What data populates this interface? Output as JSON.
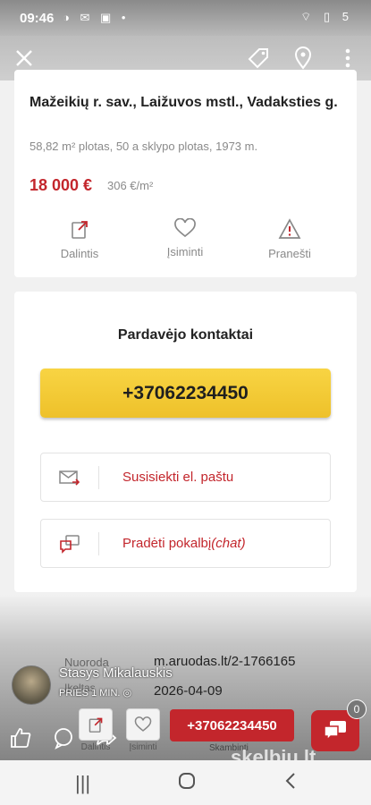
{
  "status_bar": {
    "time": "09:46",
    "left_icons": "◑ ✉ ▣ •",
    "right_icons": "⌔ ▯ 5"
  },
  "top_bar": {
    "close_icon": "close-icon",
    "tag_icon": "tag-icon",
    "location_icon": "location-pin-icon",
    "menu_icon": "more-vert-icon"
  },
  "listing": {
    "address": "Mažeikių r. sav., Laižuvos mstl., Vadaksties g.",
    "details": "58,82 m² plotas, 50 a sklypo plotas, 1973 m.",
    "price": "18 000 €",
    "price_per_m2": "306 €/m²"
  },
  "actions": [
    {
      "label": "Dalintis",
      "icon": "share-icon"
    },
    {
      "label": "Įsiminti",
      "icon": "heart-icon"
    },
    {
      "label": "Pranešti",
      "icon": "warning-icon"
    }
  ],
  "contacts": {
    "title": "Pardavėjo kontaktai",
    "phone": "+37062234450",
    "email_label": "Susisiekti el. paštu",
    "chat_label": "Pradėti pokalbį",
    "chat_suffix": "(chat)"
  },
  "reference": {
    "label": "Nuoroda",
    "value": "m.aruodas.lt/2-1766165",
    "date_label": "Įkeltas",
    "date_value": "2026-04-09"
  },
  "user": {
    "name": "Stasys Mikalauskis",
    "meta": "PRIES 1 MIN."
  },
  "bottom_nav": {
    "share_label": "Dalintis",
    "save_label": "Įsiminti",
    "call_label": "+37062234450",
    "call_sub": "Skambinti",
    "chat_count": "0"
  },
  "watermark": "skelbiu.lt",
  "colors": {
    "accent": "#c3262c",
    "phone_button": "#f1c531"
  }
}
